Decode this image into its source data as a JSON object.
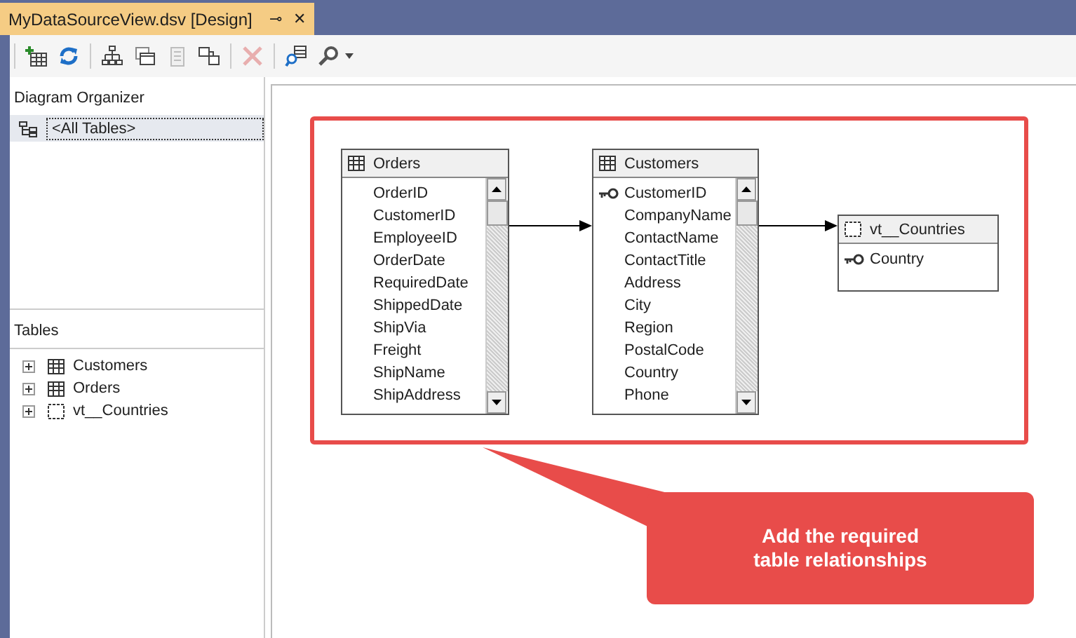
{
  "tab": {
    "title": "MyDataSourceView.dsv [Design]",
    "pin": "⊸",
    "close": "✕"
  },
  "diagram_organizer": {
    "title": "Diagram Organizer",
    "items": [
      {
        "label": "<All Tables>",
        "selected": true
      }
    ]
  },
  "tables_panel": {
    "title": "Tables",
    "items": [
      {
        "label": "Customers",
        "kind": "table",
        "expanded": false
      },
      {
        "label": "Orders",
        "kind": "table",
        "expanded": false
      },
      {
        "label": "vt__Countries",
        "kind": "view",
        "expanded": false
      }
    ]
  },
  "diagram": {
    "tables": [
      {
        "name": "Orders",
        "kind": "table",
        "columns": [
          {
            "name": "OrderID",
            "key": false
          },
          {
            "name": "CustomerID",
            "key": false
          },
          {
            "name": "EmployeeID",
            "key": false
          },
          {
            "name": "OrderDate",
            "key": false
          },
          {
            "name": "RequiredDate",
            "key": false
          },
          {
            "name": "ShippedDate",
            "key": false
          },
          {
            "name": "ShipVia",
            "key": false
          },
          {
            "name": "Freight",
            "key": false
          },
          {
            "name": "ShipName",
            "key": false
          },
          {
            "name": "ShipAddress",
            "key": false
          }
        ]
      },
      {
        "name": "Customers",
        "kind": "table",
        "columns": [
          {
            "name": "CustomerID",
            "key": true
          },
          {
            "name": "CompanyName",
            "key": false
          },
          {
            "name": "ContactName",
            "key": false
          },
          {
            "name": "ContactTitle",
            "key": false
          },
          {
            "name": "Address",
            "key": false
          },
          {
            "name": "City",
            "key": false
          },
          {
            "name": "Region",
            "key": false
          },
          {
            "name": "PostalCode",
            "key": false
          },
          {
            "name": "Country",
            "key": false
          },
          {
            "name": "Phone",
            "key": false
          }
        ]
      },
      {
        "name": "vt__Countries",
        "kind": "view",
        "columns": [
          {
            "name": "Country",
            "key": true
          }
        ]
      }
    ]
  },
  "callout": {
    "text": "Add the required table relationships"
  }
}
